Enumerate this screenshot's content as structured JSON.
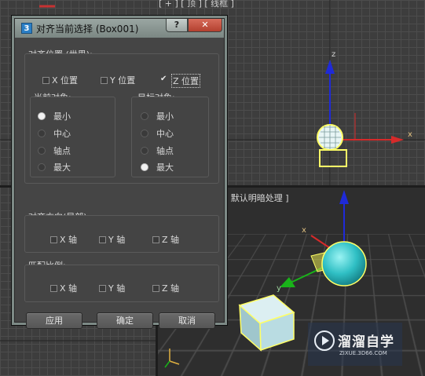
{
  "viewport": {
    "top_label": "[ + ] [ 顶 ] [ 线框 ]",
    "persp_label": "[ 默认明暗处理 ]",
    "axis_z": "z",
    "axis_x": "x",
    "axis_y": "y",
    "colors": {
      "grid_bg": "#3d3d3d",
      "grid_line": "#4c4c4c",
      "persp_bg": "#2e2e2e",
      "gizmo_z": "#1f2ad8",
      "gizmo_x": "#d62a2a",
      "gizmo_y": "#19b319",
      "sphere": "#3fd0d0",
      "box": "#bfe1e6",
      "selection": "#ffff66"
    }
  },
  "watermark": {
    "title": "溜溜自学",
    "subtitle": "ZIXUE.3D66.COM",
    "icon": "play-logo-icon"
  },
  "dialog": {
    "icon_text": "3",
    "title": "对齐当前选择 (Box001)",
    "help_label": "?",
    "close_label": "✕",
    "align_position": {
      "title": "对齐位置 (世界):",
      "x_label": "X 位置",
      "y_label": "Y 位置",
      "z_label": "Z 位置",
      "x_checked": false,
      "y_checked": false,
      "z_checked": true
    },
    "current_object": {
      "title": "当前对象:",
      "options": [
        "最小",
        "中心",
        "轴点",
        "最大"
      ],
      "selected": "最小"
    },
    "target_object": {
      "title": "目标对象:",
      "options": [
        "最小",
        "中心",
        "轴点",
        "最大"
      ],
      "selected": "最大"
    },
    "align_orientation": {
      "title": "对齐方向(局部):",
      "x_label": "X 轴",
      "y_label": "Y 轴",
      "z_label": "Z 轴"
    },
    "match_scale": {
      "title": "匹配比例:",
      "x_label": "X 轴",
      "y_label": "Y 轴",
      "z_label": "Z 轴"
    },
    "buttons": {
      "apply": "应用",
      "ok": "确定",
      "cancel": "取消"
    }
  }
}
